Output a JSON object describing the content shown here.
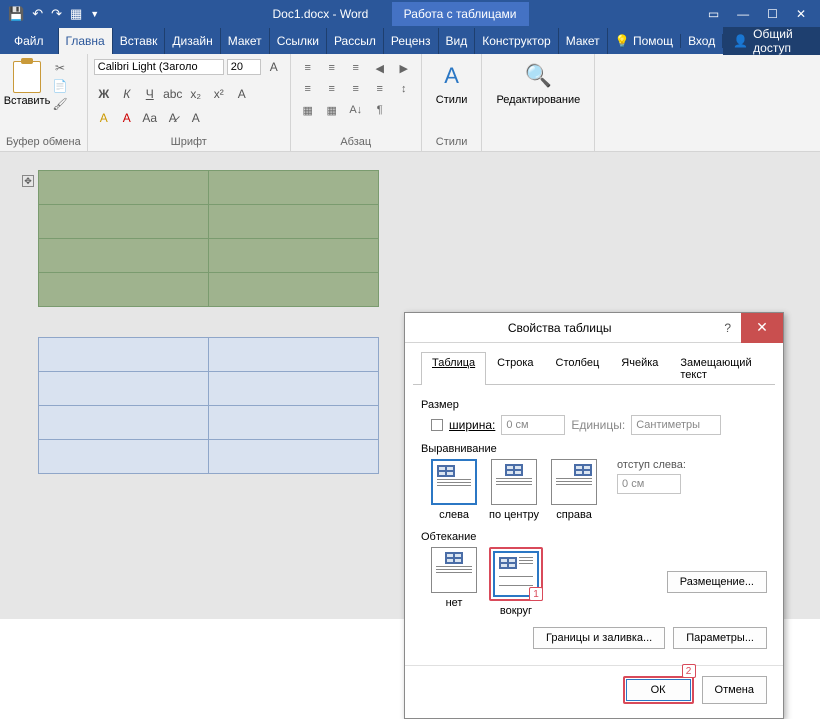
{
  "titlebar": {
    "doc_title": "Doc1.docx - Word",
    "context_tab": "Работа с таблицами"
  },
  "tabs": {
    "file": "Файл",
    "home": "Главна",
    "insert": "Вставк",
    "design": "Дизайн",
    "layout": "Макет",
    "refs": "Ссылки",
    "mail": "Рассыл",
    "review": "Реценз",
    "view": "Вид",
    "ctor": "Конструктор",
    "layout2": "Макет",
    "help": "Помощ",
    "signin": "Вход",
    "share": "Общий доступ"
  },
  "ribbon": {
    "paste": "Вставить",
    "clipboard": "Буфер обмена",
    "font_name": "Calibri Light (Заголо",
    "font_size": "20",
    "font_group": "Шрифт",
    "para_group": "Абзац",
    "styles": "Стили",
    "styles_group": "Стили",
    "editing": "Редактирование"
  },
  "dialog": {
    "title": "Свойства таблицы",
    "tabs": {
      "table": "Таблица",
      "row": "Строка",
      "col": "Столбец",
      "cell": "Ячейка",
      "alt": "Замещающий текст"
    },
    "size_label": "Размер",
    "width_label": "ширина:",
    "width_val": "0 см",
    "units_label": "Единицы:",
    "units_val": "Сантиметры",
    "align_label": "Выравнивание",
    "align_left": "слева",
    "align_center": "по центру",
    "align_right": "справа",
    "indent_label": "отступ слева:",
    "indent_val": "0 см",
    "wrap_label": "Обтекание",
    "wrap_none": "нет",
    "wrap_around": "вокруг",
    "placement": "Размещение...",
    "borders": "Границы и заливка...",
    "params": "Параметры...",
    "ok": "ОК",
    "cancel": "Отмена",
    "badge1": "1",
    "badge2": "2"
  }
}
